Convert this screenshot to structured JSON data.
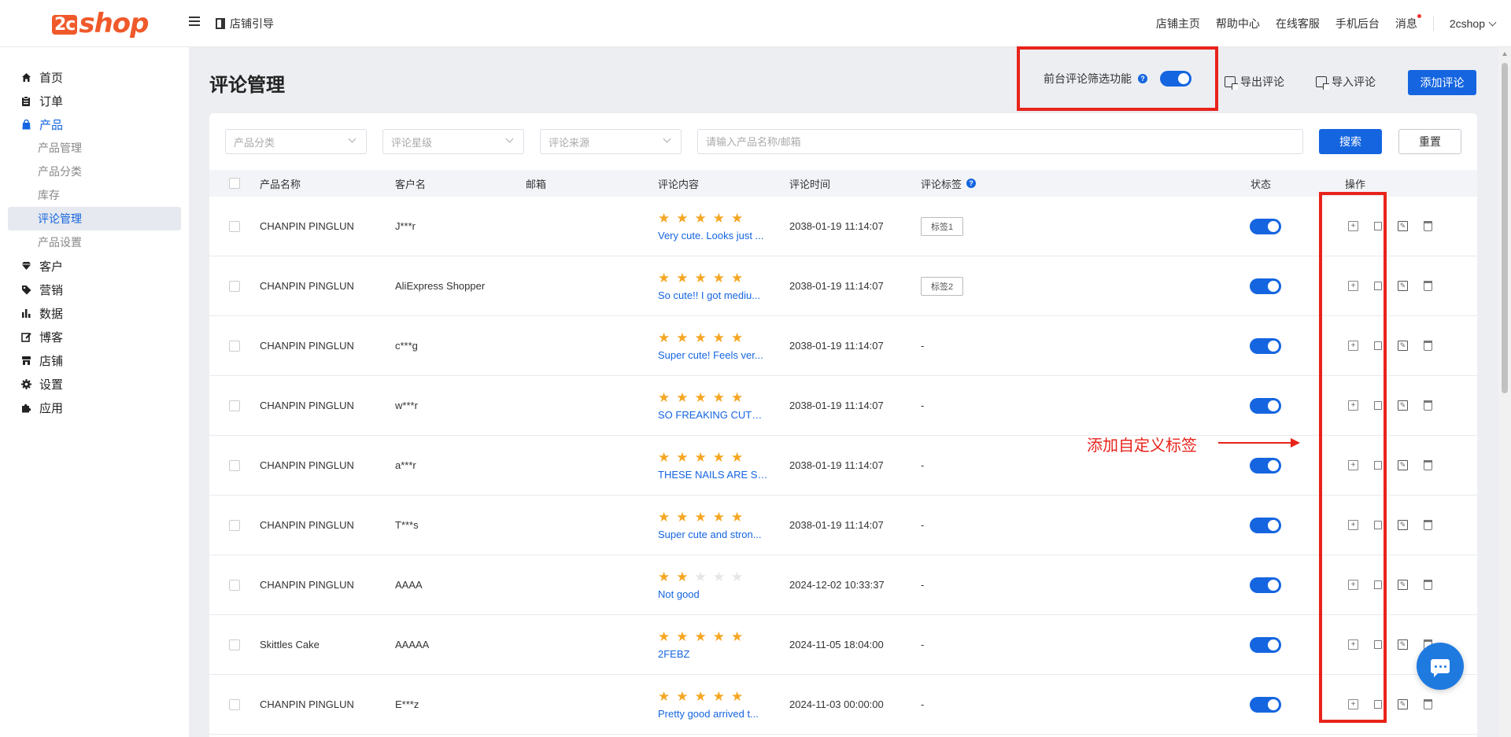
{
  "topbar": {
    "logo_two": "2c",
    "logo_shop": "shop",
    "guide": "店铺引导",
    "nav": [
      "店铺主页",
      "帮助中心",
      "在线客服",
      "手机后台",
      "消息"
    ],
    "user": "2cshop"
  },
  "sidebar": {
    "items": [
      {
        "label": "首页",
        "icon": "home-icon"
      },
      {
        "label": "订单",
        "icon": "clipboard-icon"
      },
      {
        "label": "产品",
        "icon": "bag-icon",
        "active": true
      },
      {
        "label": "客户",
        "icon": "diamond-icon"
      },
      {
        "label": "营销",
        "icon": "tag-icon"
      },
      {
        "label": "数据",
        "icon": "bar-chart-icon"
      },
      {
        "label": "博客",
        "icon": "edit-icon"
      },
      {
        "label": "店铺",
        "icon": "store-icon"
      },
      {
        "label": "设置",
        "icon": "gear-icon"
      },
      {
        "label": "应用",
        "icon": "puzzle-icon"
      }
    ],
    "product_sub": [
      "产品管理",
      "产品分类",
      "库存",
      "评论管理",
      "产品设置"
    ]
  },
  "header": {
    "title": "评论管理",
    "filter_toggle_label": "前台评论筛选功能",
    "filter_toggle_on": true,
    "export_label": "导出评论",
    "import_label": "导入评论",
    "add_label": "添加评论"
  },
  "filters": {
    "category_placeholder": "产品分类",
    "rating_placeholder": "评论星级",
    "source_placeholder": "评论来源",
    "search_placeholder": "请输入产品名称/邮箱",
    "search_label": "搜索",
    "reset_label": "重置"
  },
  "table": {
    "headers": {
      "product": "产品名称",
      "customer": "客户名",
      "email": "邮箱",
      "content": "评论内容",
      "time": "评论时间",
      "tags": "评论标签",
      "status": "状态",
      "actions": "操作"
    },
    "rows": [
      {
        "product": "CHANPIN PINGLUN",
        "customer": "J***r",
        "email": "",
        "rating": 5,
        "text": "Very cute. Looks just ...",
        "time": "2038-01-19 11:14:07",
        "tag": "标签1",
        "status_on": true
      },
      {
        "product": "CHANPIN PINGLUN",
        "customer": "AliExpress Shopper",
        "email": "",
        "rating": 5,
        "text": "So cute!! I got mediu...",
        "time": "2038-01-19 11:14:07",
        "tag": "标签2",
        "status_on": true
      },
      {
        "product": "CHANPIN PINGLUN",
        "customer": "c***g",
        "email": "",
        "rating": 5,
        "text": "Super cute! Feels ver...",
        "time": "2038-01-19 11:14:07",
        "tag": "-",
        "status_on": true
      },
      {
        "product": "CHANPIN PINGLUN",
        "customer": "w***r",
        "email": "",
        "rating": 5,
        "text": "SO FREAKING CUTEE...",
        "time": "2038-01-19 11:14:07",
        "tag": "-",
        "status_on": true
      },
      {
        "product": "CHANPIN PINGLUN",
        "customer": "a***r",
        "email": "",
        "rating": 5,
        "text": "THESE NAILS ARE SO...",
        "time": "2038-01-19 11:14:07",
        "tag": "-",
        "status_on": true
      },
      {
        "product": "CHANPIN PINGLUN",
        "customer": "T***s",
        "email": "",
        "rating": 5,
        "text": "Super cute and stron...",
        "time": "2038-01-19 11:14:07",
        "tag": "-",
        "status_on": true
      },
      {
        "product": "CHANPIN PINGLUN",
        "customer": "AAAA",
        "email": "",
        "rating": 2,
        "text": "Not good",
        "time": "2024-12-02 10:33:37",
        "tag": "-",
        "status_on": true
      },
      {
        "product": "Skittles Cake",
        "customer": "AAAAA",
        "email": "",
        "rating": 5,
        "text": "2FEBZ",
        "time": "2024-11-05 18:04:00",
        "tag": "-",
        "status_on": true
      },
      {
        "product": "CHANPIN PINGLUN",
        "customer": "E***z",
        "email": "",
        "rating": 5,
        "text": "Pretty good arrived t...",
        "time": "2024-11-03 00:00:00",
        "tag": "-",
        "status_on": true
      }
    ]
  },
  "annotation": {
    "label": "添加自定义标签"
  },
  "colors": {
    "accent": "#1565e0",
    "brand": "#f0592a",
    "annotation": "#e8231b",
    "star": "#f5a623"
  }
}
